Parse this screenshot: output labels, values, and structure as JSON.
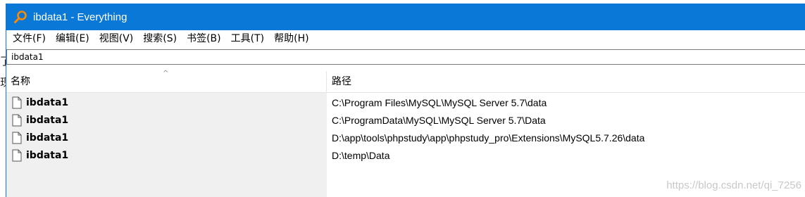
{
  "window": {
    "title": "ibdata1 - Everything"
  },
  "background_fragments": [
    "了",
    "现"
  ],
  "menu": [
    {
      "label": "文件(F)"
    },
    {
      "label": "编辑(E)"
    },
    {
      "label": "视图(V)"
    },
    {
      "label": "搜索(S)"
    },
    {
      "label": "书签(B)"
    },
    {
      "label": "工具(T)"
    },
    {
      "label": "帮助(H)"
    }
  ],
  "search": {
    "value": "ibdata1"
  },
  "columns": {
    "name": "名称",
    "path": "路径"
  },
  "results": [
    {
      "name": "ibdata1",
      "path": "C:\\Program Files\\MySQL\\MySQL Server 5.7\\data"
    },
    {
      "name": "ibdata1",
      "path": "C:\\ProgramData\\MySQL\\MySQL Server 5.7\\Data"
    },
    {
      "name": "ibdata1",
      "path": "D:\\app\\tools\\phpstudy\\app\\phpstudy_pro\\Extensions\\MySQL5.7.26\\data"
    },
    {
      "name": "ibdata1",
      "path": "D:\\temp\\Data"
    }
  ],
  "watermark": "https://blog.csdn.net/qi_7256",
  "colors": {
    "titlebar": "#0a78d7",
    "name_column_bg": "#f0f0f0"
  }
}
